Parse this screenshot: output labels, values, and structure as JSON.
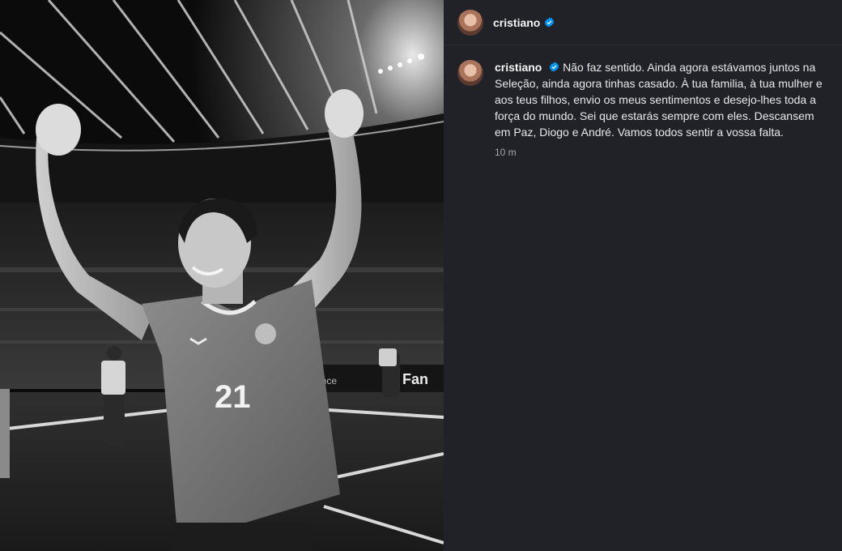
{
  "post": {
    "image": {
      "description_icon": "photo",
      "jersey_number": "21",
      "board_text": "Fan"
    },
    "header": {
      "username": "cristiano",
      "verified": true,
      "verified_color": "#0095f6"
    },
    "caption": {
      "username": "cristiano",
      "text": "Não faz sentido. Ainda agora estávamos juntos na Seleção, ainda agora tinhas casado. À tua familia, à tua mulher e aos teus filhos, envio os meus sentimentos e desejo-lhes toda a força do mundo. Sei que estarás sempre com eles. Descansem em Paz, Diogo e André. Vamos todos sentir a vossa falta.",
      "time": "10 m"
    }
  }
}
